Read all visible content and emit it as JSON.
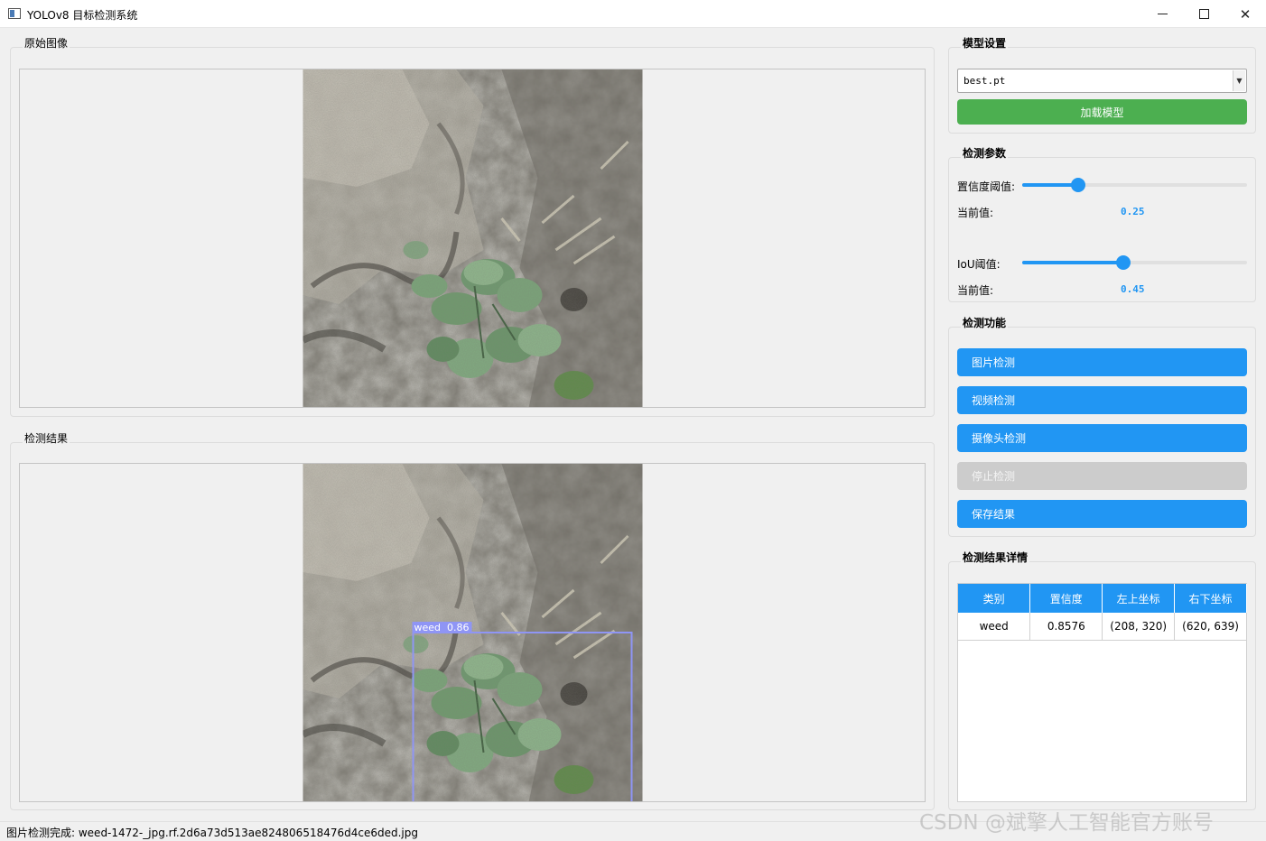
{
  "window": {
    "title": "YOLOv8 目标检测系统",
    "minimize_icon": "minimize-icon",
    "maximize_icon": "maximize-icon",
    "close_icon": "close-icon"
  },
  "original_panel": {
    "title": "原始图像"
  },
  "result_panel": {
    "title": "检测结果",
    "detection_label": "weed  0.86"
  },
  "model_settings": {
    "title": "模型设置",
    "model_select": "best.pt",
    "load_button": "加载模型"
  },
  "detection_params": {
    "title": "检测参数",
    "confidence_label": "置信度阈值:",
    "confidence_current_label": "当前值:",
    "confidence_value": "0.25",
    "confidence_level": 0.25,
    "iou_label": "IoU阈值:",
    "iou_current_label": "当前值:",
    "iou_value": "0.45",
    "iou_level": 0.45
  },
  "detection_functions": {
    "title": "检测功能",
    "image_detect": "图片检测",
    "video_detect": "视频检测",
    "camera_detect": "摄像头检测",
    "stop_detect": "停止检测",
    "save_results": "保存结果"
  },
  "results_table": {
    "title": "检测结果详情",
    "headers": [
      "类别",
      "置信度",
      "左上坐标",
      "右下坐标"
    ],
    "rows": [
      [
        "weed",
        "0.8576",
        "(208, 320)",
        "(620, 639)"
      ]
    ]
  },
  "status": {
    "text": "图片检测完成: weed-1472-_jpg.rf.2d6a73d513ae824806518476d4ce6ded.jpg"
  },
  "watermark": "CSDN @斌擎人工智能官方账号",
  "colors": {
    "accent_blue": "#2196f3",
    "load_green": "#4caf50",
    "disabled_gray": "#cccccc",
    "bbox_color": "#8f95f5"
  }
}
